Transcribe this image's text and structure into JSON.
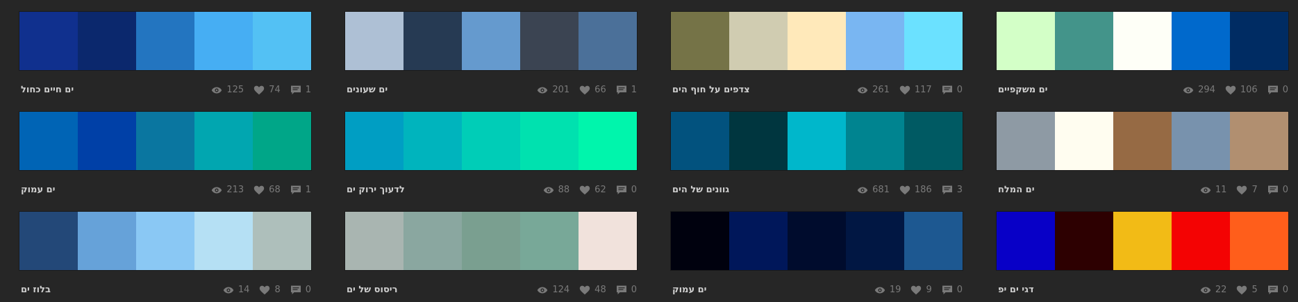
{
  "palettes": [
    {
      "title": "ים משקפיים",
      "views": "294",
      "likes": "106",
      "comments": "0",
      "colors": [
        "#d3ffc7",
        "#43948a",
        "#fefff7",
        "#0069cc",
        "#002c63"
      ]
    },
    {
      "title": "צדפים על חוף הים",
      "views": "261",
      "likes": "117",
      "comments": "0",
      "colors": [
        "#757347",
        "#d0ccb1",
        "#ffe9ba",
        "#79b6f2",
        "#6be1ff"
      ]
    },
    {
      "title": "ים שעונים",
      "views": "201",
      "likes": "66",
      "comments": "1",
      "colors": [
        "#aec0d5",
        "#263a53",
        "#659ace",
        "#3b4452",
        "#4b7099"
      ]
    },
    {
      "title": "ים חיים כחול",
      "views": "125",
      "likes": "74",
      "comments": "1",
      "colors": [
        "#10308e",
        "#0b286d",
        "#2375c0",
        "#46aef3",
        "#53c1f4"
      ]
    },
    {
      "title": "ים המלח",
      "views": "11",
      "likes": "7",
      "comments": "0",
      "colors": [
        "#8e9aa4",
        "#fffdf0",
        "#966a44",
        "#7892ad",
        "#b18f70"
      ]
    },
    {
      "title": "גוונים של הים",
      "views": "681",
      "likes": "186",
      "comments": "3",
      "colors": [
        "#02527e",
        "#00363f",
        "#00b7cb",
        "#008490",
        "#005a63"
      ]
    },
    {
      "title": "לדעוך ירוק ים",
      "views": "88",
      "likes": "62",
      "comments": "0",
      "colors": [
        "#009ec3",
        "#00b4bd",
        "#00cdb7",
        "#00e1af",
        "#00f5ac"
      ]
    },
    {
      "title": "ים עמוק",
      "views": "213",
      "likes": "68",
      "comments": "1",
      "colors": [
        "#0064b5",
        "#0040a7",
        "#0a76a0",
        "#01a6b0",
        "#00a688"
      ]
    },
    {
      "title": "דגי ים יפ",
      "views": "22",
      "likes": "5",
      "comments": "0",
      "colors": [
        "#0800c7",
        "#2d0001",
        "#f2bb16",
        "#f40303",
        "#ff5e1b"
      ]
    },
    {
      "title": "ים עמוק",
      "views": "19",
      "likes": "9",
      "comments": "0",
      "colors": [
        "#00010e",
        "#00175a",
        "#000c2d",
        "#011743",
        "#1d5891"
      ]
    },
    {
      "title": "ריסוס של ים",
      "views": "124",
      "likes": "48",
      "comments": "0",
      "colors": [
        "#a9b5b1",
        "#8aa7a0",
        "#7a9f90",
        "#78a898",
        "#f1e2dc"
      ]
    },
    {
      "title": "בלוז ים",
      "views": "14",
      "likes": "8",
      "comments": "0",
      "colors": [
        "#234878",
        "#66a2d9",
        "#8ac8f4",
        "#b5e0f4",
        "#aebfbb"
      ]
    }
  ],
  "ui": {
    "icon_color": "#7a7a7a",
    "title_color": "#cfcfcf",
    "background": "#262626"
  }
}
